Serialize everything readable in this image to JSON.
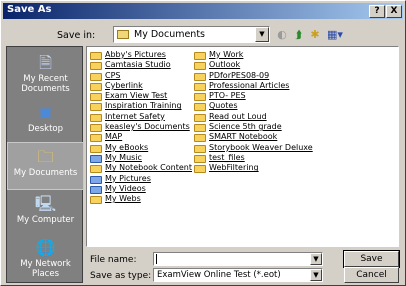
{
  "window": {
    "title": "Save As",
    "help_label": "?",
    "close_label": "X"
  },
  "location": {
    "label": "Save in:",
    "value": "My Documents"
  },
  "toolbar": {
    "back_icon": "back-icon",
    "up_icon": "up-folder-icon",
    "new_folder_icon": "new-folder-icon",
    "views_icon": "views-menu-icon"
  },
  "places": [
    {
      "label": "My Recent Documents",
      "icon": "recent-documents-icon"
    },
    {
      "label": "Desktop",
      "icon": "desktop-icon"
    },
    {
      "label": "My Documents",
      "icon": "my-documents-icon"
    },
    {
      "label": "My Computer",
      "icon": "my-computer-icon"
    },
    {
      "label": "My Network Places",
      "icon": "network-places-icon"
    }
  ],
  "files": {
    "col1": [
      "Abby's Pictures",
      "Camtasia Studio",
      "CPS",
      "Cyberlink",
      "Exam View Test",
      "Inspiration Training",
      "Internet Safety",
      "keasley's Documents",
      "MAP",
      "My eBooks",
      "My Music",
      "My Notebook Content",
      "My Pictures",
      "My Videos",
      "My Webs"
    ],
    "col2": [
      "My Work",
      "Outlook",
      "PDforPES08-09",
      "Professional Articles",
      "PTO- PES",
      "Quotes",
      "Read out Loud",
      "Science 5th grade",
      "SMART Notebook",
      "Storybook Weaver Deluxe",
      "test_files",
      "WebFiltering"
    ]
  },
  "form": {
    "filename_label": "File name:",
    "filename_value": "",
    "filetype_label": "Save as type:",
    "filetype_value": "ExamView Online Test (*.eot)"
  },
  "buttons": {
    "save": "Save",
    "cancel": "Cancel"
  }
}
